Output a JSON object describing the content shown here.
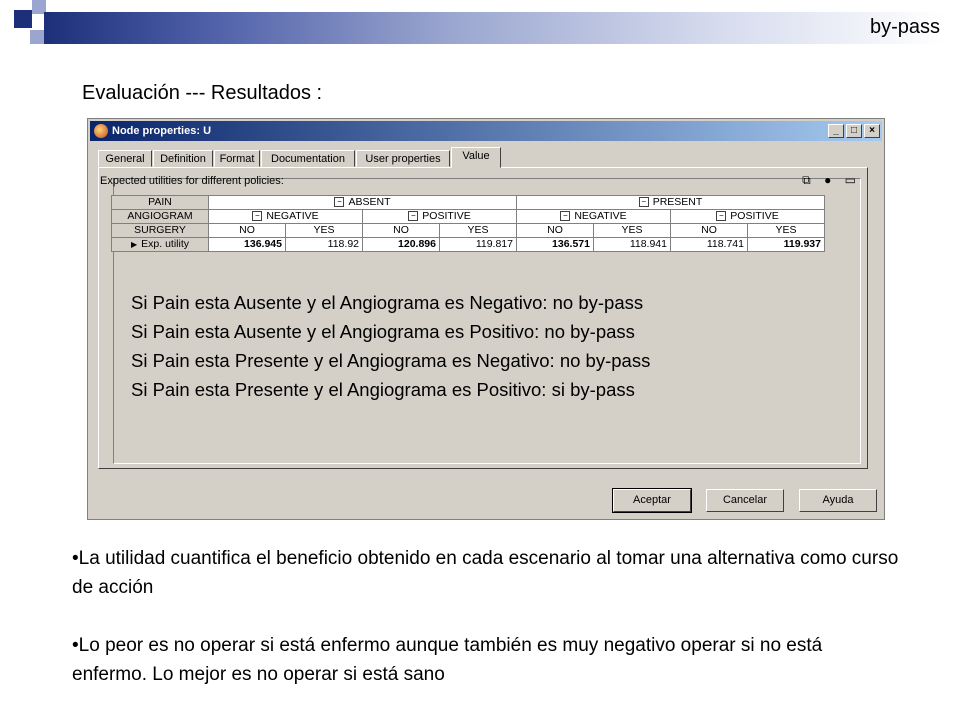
{
  "header": {
    "topword": "by-pass",
    "title": "Evaluación --- Resultados :"
  },
  "window": {
    "title": "Node properties: U",
    "tabs": [
      "General",
      "Definition",
      "Format",
      "Documentation",
      "User properties",
      "Value"
    ],
    "active_tab": "Value",
    "caption": "Expected utilities for different policies:",
    "table": {
      "pain_label": "PAIN",
      "angiogram_label": "ANGIOGRAM",
      "surgery_label": "SURGERY",
      "pain_values": [
        "ABSENT",
        "PRESENT"
      ],
      "angiogram_values": [
        "NEGATIVE",
        "POSITIVE",
        "NEGATIVE",
        "POSITIVE"
      ],
      "surgery_values": [
        "NO",
        "YES",
        "NO",
        "YES",
        "NO",
        "YES",
        "NO",
        "YES"
      ],
      "row_label": "Exp. utility",
      "utilities": [
        "136.945",
        "118.92",
        "120.896",
        "119.817",
        "136.571",
        "118.941",
        "118.741",
        "119.937"
      ]
    },
    "buttons": {
      "ok": "Aceptar",
      "cancel": "Cancelar",
      "help": "Ayuda"
    }
  },
  "overlay_lines": [
    "Si Pain esta Ausente y el Angiograma es Negativo: no by-pass",
    "Si Pain esta Ausente y el Angiograma es Positivo: no by-pass",
    "Si Pain esta Presente y el Angiograma es Negativo: no by-pass",
    "Si Pain esta Presente y el Angiograma es Positivo: si by-pass"
  ],
  "bullets": [
    "•La utilidad cuantifica el beneficio obtenido en cada escenario al tomar una  alternativa como curso de acción",
    "•Lo peor es no operar si está enfermo aunque también es muy negativo operar si no está enfermo. Lo mejor es no operar si está sano"
  ]
}
